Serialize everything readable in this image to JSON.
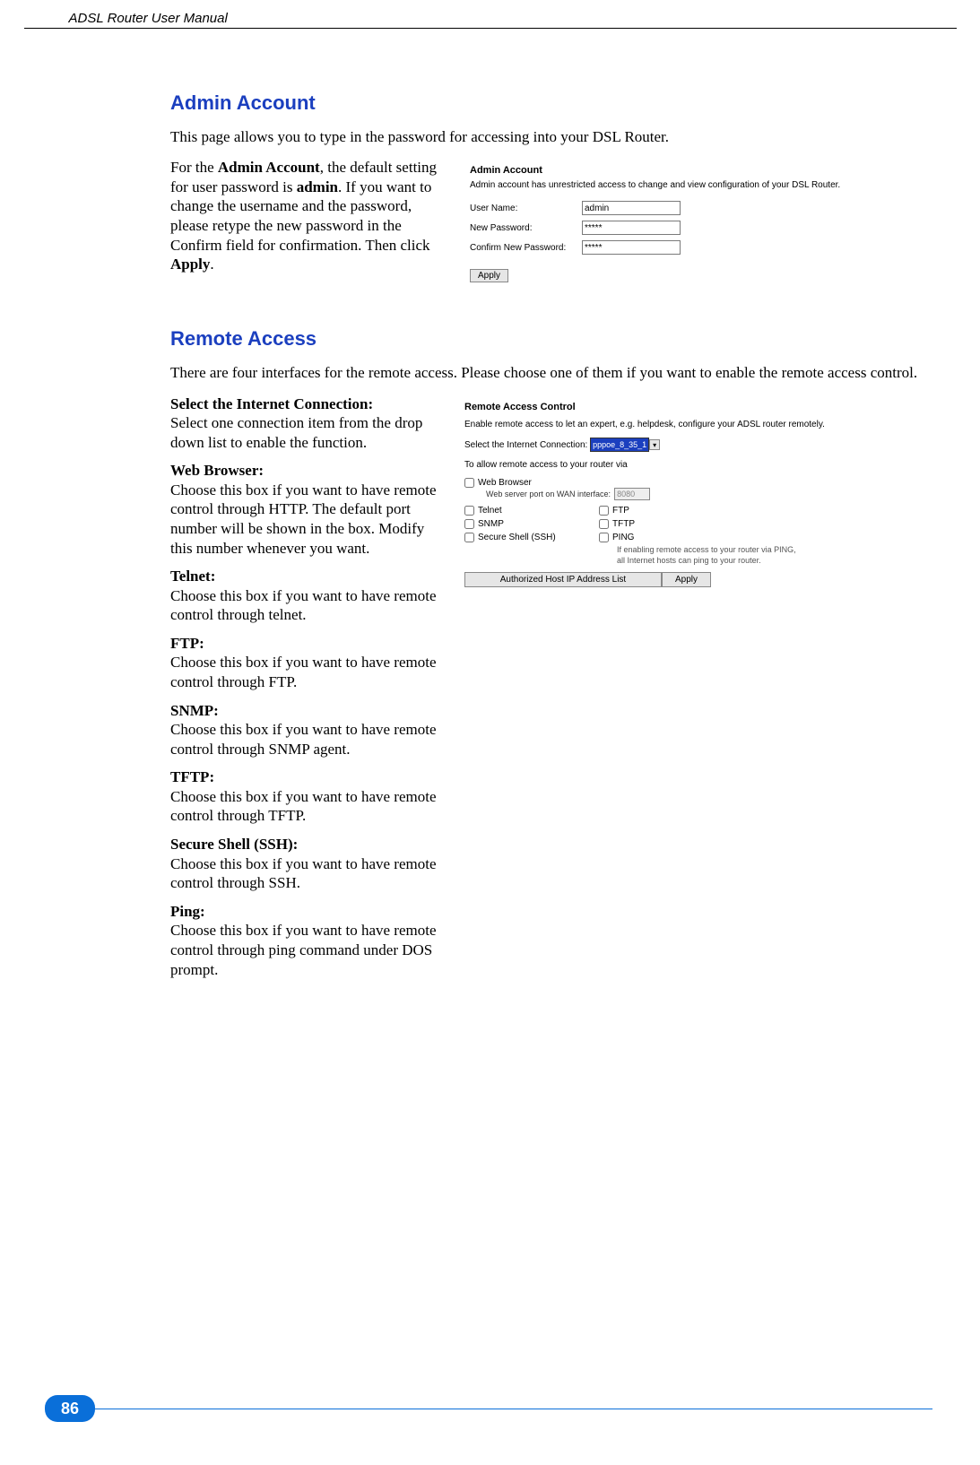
{
  "header": {
    "title": "ADSL Router User Manual"
  },
  "page_number": "86",
  "admin": {
    "heading": "Admin Account",
    "intro": "This page allows you to type in the password for accessing into your DSL Router.",
    "para_pre": "For the ",
    "para_b1": "Admin Account",
    "para_mid1": ", the default setting for user password is ",
    "para_b2": "admin",
    "para_mid2": ". If you want to change the username and the password, please retype the new password in the Confirm field for confirmation. Then click ",
    "para_b3": "Apply",
    "para_end": ".",
    "shot": {
      "title": "Admin Account",
      "desc": "Admin account has unrestricted access to change and view configuration of your DSL Router.",
      "labels": {
        "user": "User Name:",
        "newpw": "New Password:",
        "confirm": "Confirm New Password:"
      },
      "values": {
        "user": "admin",
        "newpw": "*****",
        "confirm": "*****"
      },
      "apply": "Apply"
    }
  },
  "remote": {
    "heading": "Remote Access",
    "intro": "There are four interfaces for the remote access. Please choose one of them if you want to enable the remote access control.",
    "defs": [
      {
        "title": "Select the Internet Connection:",
        "body": "Select one connection item from the drop down list to enable the function."
      },
      {
        "title": "Web Browser:",
        "body": "Choose this box if you want to have remote control through HTTP. The default port number will be shown in the box. Modify this number whenever you want."
      },
      {
        "title": "Telnet:",
        "body": "Choose this box if you want to have remote control through telnet."
      },
      {
        "title": "FTP:",
        "body": "Choose this box if you want to have remote control through FTP."
      },
      {
        "title": "SNMP:",
        "body": "Choose this box if you want to have remote control through SNMP agent."
      },
      {
        "title": "TFTP:",
        "body": "Choose this box if you want to have remote control through TFTP."
      },
      {
        "title": "Secure Shell (SSH):",
        "body": "Choose this box if you want to have remote control through SSH."
      },
      {
        "title": "Ping:",
        "body": "Choose this box if you want to have remote control through ping command under DOS prompt."
      }
    ],
    "shot": {
      "title": "Remote Access Control",
      "desc": "Enable remote access to let an expert, e.g. helpdesk, configure your ADSL router remotely.",
      "select_label": "Select the Internet Connection:",
      "select_value": "pppoe_8_35_1",
      "allow_text": "To allow remote access to your router via",
      "options": {
        "web": "Web Browser",
        "ftp": "FTP",
        "telnet": "Telnet",
        "snmp": "SNMP",
        "tftp": "TFTP",
        "ssh": "Secure Shell (SSH)",
        "ping": "PING"
      },
      "web_port_label": "Web server port on WAN interface:",
      "web_port_value": "8080",
      "ping_note1": "If enabling remote access to your router via PING,",
      "ping_note2": "all Internet hosts can ping to your router.",
      "btn_hostlist": "Authorized Host IP Address List",
      "btn_apply": "Apply"
    }
  }
}
